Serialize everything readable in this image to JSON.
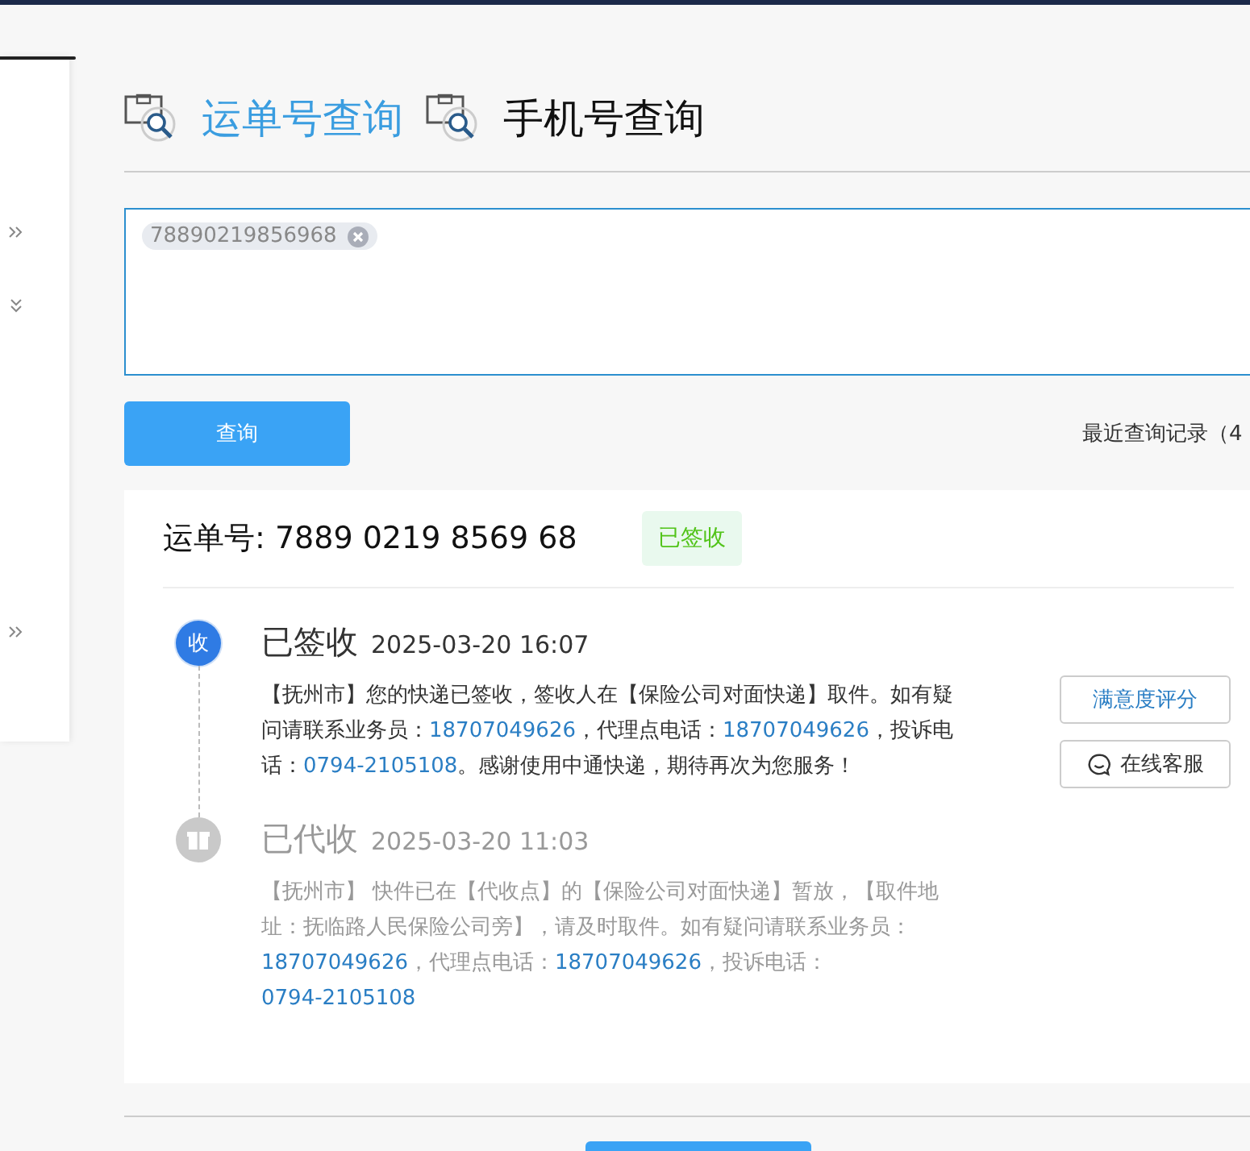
{
  "sidebar": {
    "items": [
      {
        "expanded": false
      },
      {
        "expanded": true
      },
      {
        "expanded": false
      }
    ]
  },
  "tabs": [
    {
      "label": "运单号查询",
      "selected": true
    },
    {
      "label": "手机号查询",
      "selected": false
    }
  ],
  "query_box": {
    "tags": [
      "78890219856968"
    ]
  },
  "query_button": "查询",
  "recent_history": "最近查询记录（4",
  "result": {
    "tracking_label": "运单号: 7889 0219 8569 68",
    "status_badge": "已签收",
    "events": [
      {
        "kind": "signed",
        "icon_text": "收",
        "current": true,
        "status": "已签收",
        "time": "2025-03-20 16:07",
        "parts": [
          {
            "kind": "text",
            "text": "【抚州市】您的快递已签收，签收人在【保险公司对面快递】取件。如有疑问请联系业务员："
          },
          {
            "kind": "phone",
            "text": "18707049626"
          },
          {
            "kind": "text",
            "text": "，代理点电话："
          },
          {
            "kind": "phone",
            "text": "18707049626"
          },
          {
            "kind": "text",
            "text": "，投诉电话："
          },
          {
            "kind": "phone",
            "text": "0794-2105108"
          },
          {
            "kind": "text",
            "text": "。感谢使用中通快递，期待再次为您服务！"
          }
        ]
      },
      {
        "kind": "collected",
        "current": false,
        "status": "已代收",
        "time": "2025-03-20 11:03",
        "parts": [
          {
            "kind": "text",
            "text": "【抚州市】 快件已在【代收点】的【保险公司对面快递】暂放，【取件地址：抚临路人民保险公司旁】，请及时取件。如有疑问请联系业务员："
          },
          {
            "kind": "phone",
            "text": "18707049626"
          },
          {
            "kind": "text",
            "text": "，代理点电话："
          },
          {
            "kind": "phone",
            "text": "18707049626"
          },
          {
            "kind": "text",
            "text": "，投诉电话："
          },
          {
            "kind": "phone",
            "text": "0794-2105108"
          }
        ]
      }
    ],
    "actions": [
      {
        "kind": "rate",
        "label": "满意度评分"
      },
      {
        "kind": "chat",
        "label": "在线客服"
      }
    ]
  }
}
